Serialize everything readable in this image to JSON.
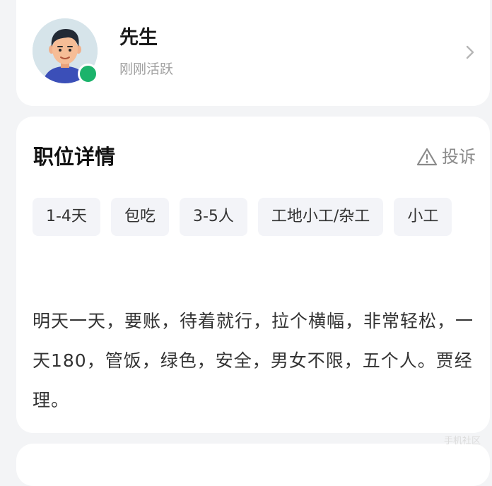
{
  "poster": {
    "name": "先生",
    "status": "刚刚活跃",
    "online_color": "#1bb36b",
    "avatar_icon": "man-avatar-icon",
    "chevron_icon": "chevron-right-icon"
  },
  "job_detail": {
    "title": "职位详情",
    "report_label": "投诉",
    "report_icon": "warning-triangle-icon",
    "tags": [
      "1-4天",
      "包吃",
      "3-5人",
      "工地小工/杂工",
      "小工"
    ],
    "description": "明天一天，要账，待着就行，拉个横幅，非常轻松，一天180，管饭，绿色，安全，男女不限，五个人。贾经理。"
  },
  "watermark": "手机社区"
}
